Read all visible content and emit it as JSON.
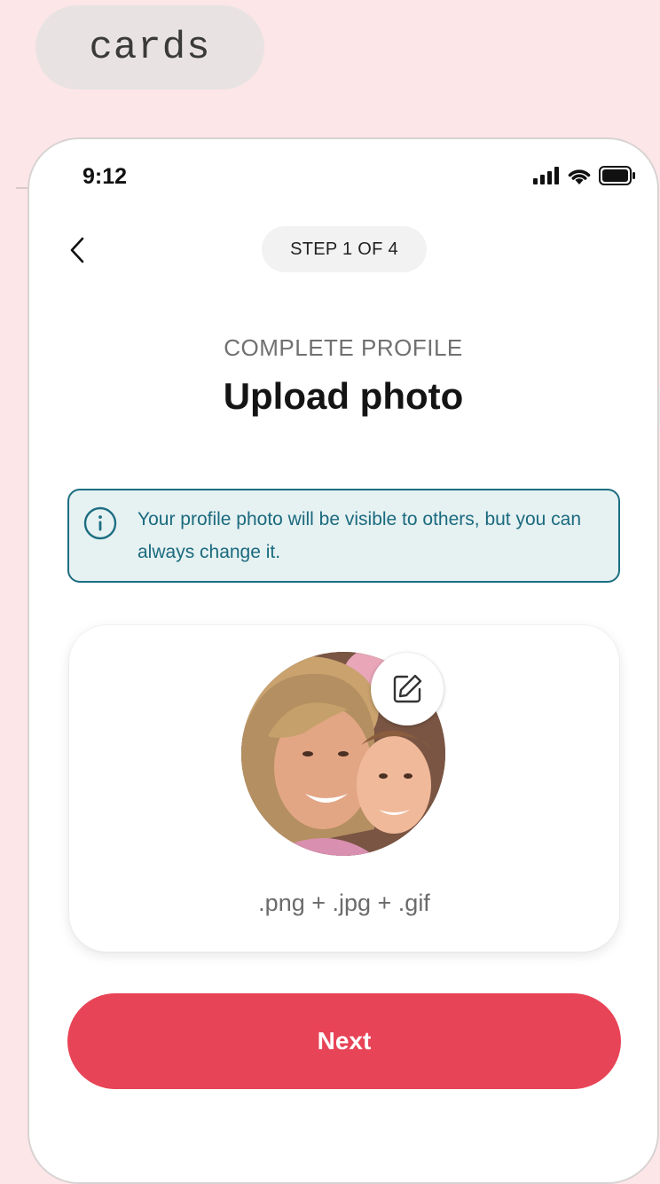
{
  "tag": {
    "label": "cards"
  },
  "status": {
    "time": "9:12"
  },
  "header": {
    "step": "STEP 1 OF 4"
  },
  "content": {
    "eyebrow": "COMPLETE PROFILE",
    "title": "Upload photo",
    "info": "Your profile photo will be visible to others, but you can always change it.",
    "formats": ".png + .jpg + .gif"
  },
  "actions": {
    "next_label": "Next"
  },
  "colors": {
    "background": "#fde6e8",
    "accent": "#e84457",
    "info_border": "#1c6e82",
    "info_bg": "#e6f1f2"
  },
  "icons": [
    "back-chevron-icon",
    "info-icon",
    "edit-icon",
    "signal-icon",
    "wifi-icon",
    "battery-icon"
  ]
}
